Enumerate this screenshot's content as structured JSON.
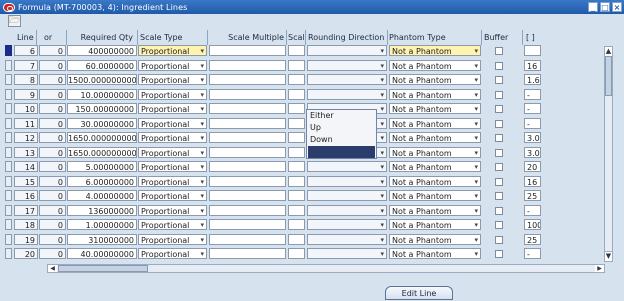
{
  "window": {
    "title": "Formula (MT-700003, 4): Ingredient Lines",
    "minimize": "_",
    "restore": "□",
    "close": "×"
  },
  "toolbar": {
    "folder_icon": "folder-open-icon"
  },
  "columns": {
    "line": "Line",
    "or": "or",
    "required_qty": "Required Qty",
    "scale_type": "Scale Type",
    "scale_multiple": "Scale Multiple",
    "scal": "Scal",
    "rounding_direction": "Rounding Direction",
    "phantom_type": "Phantom Type",
    "buffer": "Buffer",
    "extra": "[ ]"
  },
  "rows": [
    {
      "line": "6",
      "or": "0",
      "qty": "400000000",
      "scale": "Proportional",
      "phantom": "Not a Phantom",
      "extra": ""
    },
    {
      "line": "7",
      "or": "0",
      "qty": "60.0000000",
      "scale": "Proportional",
      "phantom": "Not a Phantom",
      "extra": "16"
    },
    {
      "line": "8",
      "or": "0",
      "qty": "1500.000000000",
      "scale": "Proportional",
      "phantom": "Not a Phantom",
      "extra": "1.6"
    },
    {
      "line": "9",
      "or": "0",
      "qty": "10.00000000",
      "scale": "Proportional",
      "phantom": "Not a Phantom",
      "extra": "-"
    },
    {
      "line": "10",
      "or": "0",
      "qty": "150.00000000",
      "scale": "Proportional",
      "phantom": "Not a Phantom",
      "extra": "-"
    },
    {
      "line": "11",
      "or": "0",
      "qty": "30.00000000",
      "scale": "Proportional",
      "phantom": "Not a Phantom",
      "extra": "-"
    },
    {
      "line": "12",
      "or": "0",
      "qty": "1650.000000000",
      "scale": "Proportional",
      "phantom": "Not a Phantom",
      "extra": "3.0"
    },
    {
      "line": "13",
      "or": "0",
      "qty": "1650.000000000",
      "scale": "Proportional",
      "phantom": "Not a Phantom",
      "extra": "3.0"
    },
    {
      "line": "14",
      "or": "0",
      "qty": "5.00000000",
      "scale": "Proportional",
      "phantom": "Not a Phantom",
      "extra": "20"
    },
    {
      "line": "15",
      "or": "0",
      "qty": "6.00000000",
      "scale": "Proportional",
      "phantom": "Not a Phantom",
      "extra": "16"
    },
    {
      "line": "16",
      "or": "0",
      "qty": "4.00000000",
      "scale": "Proportional",
      "phantom": "Not a Phantom",
      "extra": "25"
    },
    {
      "line": "17",
      "or": "0",
      "qty": "136000000",
      "scale": "Proportional",
      "phantom": "Not a Phantom",
      "extra": "-"
    },
    {
      "line": "18",
      "or": "0",
      "qty": "1.00000000",
      "scale": "Proportional",
      "phantom": "Not a Phantom",
      "extra": "100"
    },
    {
      "line": "19",
      "or": "0",
      "qty": "310000000",
      "scale": "Proportional",
      "phantom": "Not a Phantom",
      "extra": "25"
    },
    {
      "line": "20",
      "or": "0",
      "qty": "40.00000000",
      "scale": "Proportional",
      "phantom": "Not a Phantom",
      "extra": "-"
    }
  ],
  "rounding_popup": {
    "options": [
      "Either",
      "Up",
      "Down",
      ""
    ]
  },
  "buttons": {
    "edit_line": "Edit Line"
  },
  "colors": {
    "title_bar": "#1f5aa8",
    "selected_cell": "#fff3b0",
    "active_marker": "#1a2b8c"
  }
}
